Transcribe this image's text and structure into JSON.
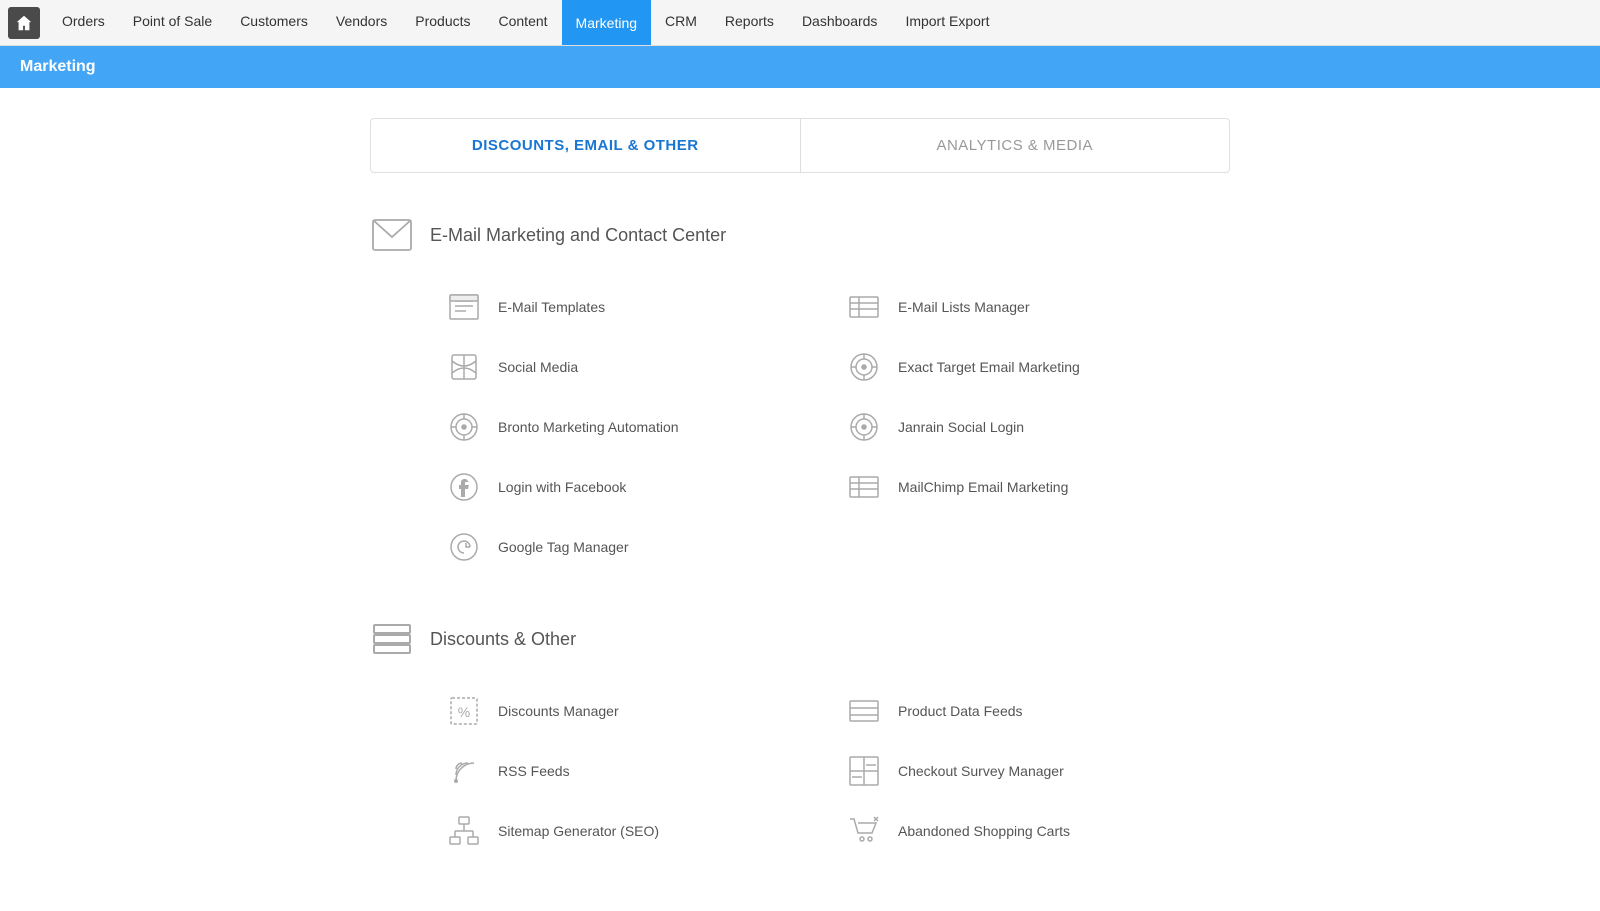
{
  "nav": {
    "home_label": "Home",
    "items": [
      {
        "id": "orders",
        "label": "Orders",
        "active": false
      },
      {
        "id": "point-of-sale",
        "label": "Point of Sale",
        "active": false
      },
      {
        "id": "customers",
        "label": "Customers",
        "active": false
      },
      {
        "id": "vendors",
        "label": "Vendors",
        "active": false
      },
      {
        "id": "products",
        "label": "Products",
        "active": false
      },
      {
        "id": "content",
        "label": "Content",
        "active": false
      },
      {
        "id": "marketing",
        "label": "Marketing",
        "active": true
      },
      {
        "id": "crm",
        "label": "CRM",
        "active": false
      },
      {
        "id": "reports",
        "label": "Reports",
        "active": false
      },
      {
        "id": "dashboards",
        "label": "Dashboards",
        "active": false
      },
      {
        "id": "import-export",
        "label": "Import Export",
        "active": false
      }
    ]
  },
  "page_header": "Marketing",
  "tabs": [
    {
      "id": "discounts-email-other",
      "label": "DISCOUNTS, EMAIL & OTHER",
      "active": true
    },
    {
      "id": "analytics-media",
      "label": "ANALYTICS & MEDIA",
      "active": false
    }
  ],
  "sections": [
    {
      "id": "email-marketing",
      "title": "E-Mail Marketing and Contact Center",
      "items": [
        {
          "id": "email-templates",
          "label": "E-Mail Templates",
          "col": 0
        },
        {
          "id": "email-lists-manager",
          "label": "E-Mail Lists Manager",
          "col": 1
        },
        {
          "id": "social-media",
          "label": "Social Media",
          "col": 0
        },
        {
          "id": "exact-target",
          "label": "Exact Target Email Marketing",
          "col": 1
        },
        {
          "id": "bronto",
          "label": "Bronto Marketing Automation",
          "col": 0
        },
        {
          "id": "janrain",
          "label": "Janrain Social Login",
          "col": 1
        },
        {
          "id": "login-facebook",
          "label": "Login with Facebook",
          "col": 0
        },
        {
          "id": "mailchimp",
          "label": "MailChimp Email Marketing",
          "col": 1
        },
        {
          "id": "google-tag",
          "label": "Google Tag Manager",
          "col": 0
        }
      ]
    },
    {
      "id": "discounts-other",
      "title": "Discounts & Other",
      "items": [
        {
          "id": "discounts-manager",
          "label": "Discounts Manager",
          "col": 0
        },
        {
          "id": "product-data-feeds",
          "label": "Product Data Feeds",
          "col": 1
        },
        {
          "id": "rss-feeds",
          "label": "RSS Feeds",
          "col": 0
        },
        {
          "id": "checkout-survey",
          "label": "Checkout Survey Manager",
          "col": 1
        },
        {
          "id": "sitemap-generator",
          "label": "Sitemap Generator (SEO)",
          "col": 0
        },
        {
          "id": "abandoned-carts",
          "label": "Abandoned Shopping Carts",
          "col": 1
        }
      ]
    }
  ]
}
